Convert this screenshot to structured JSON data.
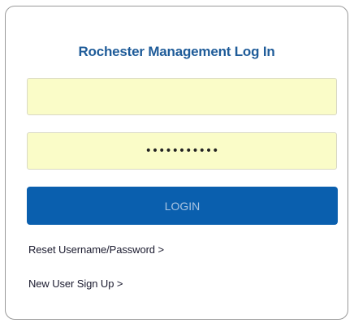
{
  "login_card": {
    "title": "Rochester Management Log In",
    "username_field": {
      "value": "",
      "placeholder": ""
    },
    "password_field": {
      "value": "•••••••••••",
      "placeholder": ""
    },
    "login_button_label": "LOGIN",
    "reset_link_label": "Reset Username/Password >",
    "signup_link_label": "New User Sign Up >"
  },
  "colors": {
    "title": "#1f5c99",
    "field_background": "#fafcc8",
    "button_background": "#0a5fae",
    "button_text": "#a9c4e2",
    "card_border": "#9a9a9a"
  }
}
